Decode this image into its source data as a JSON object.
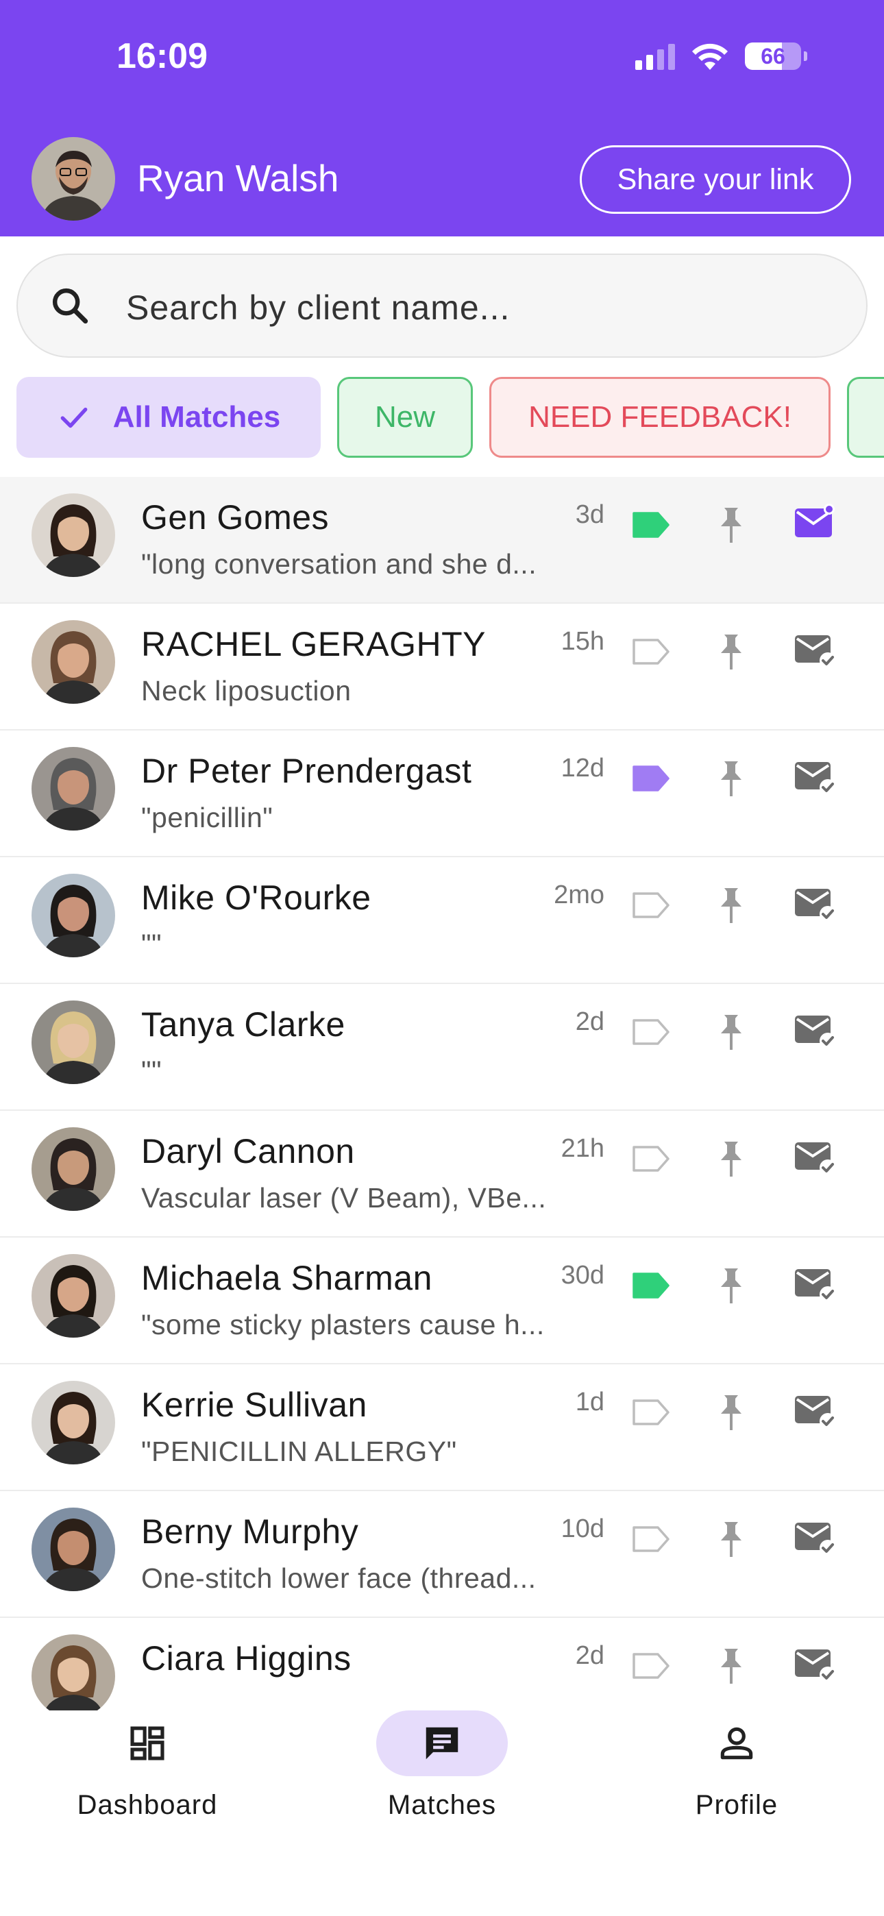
{
  "status_bar": {
    "time": "16:09",
    "battery": "66",
    "battery_level": 0.66
  },
  "header": {
    "user_name": "Ryan Walsh",
    "share_label": "Share your link"
  },
  "search": {
    "placeholder": "Search by client name..."
  },
  "filters": [
    {
      "label": "All Matches",
      "selected": true
    },
    {
      "label": "New",
      "selected": false
    },
    {
      "label": "NEED FEEDBACK!",
      "selected": false
    },
    {
      "label": "",
      "selected": false
    }
  ],
  "matches": [
    {
      "name": "Gen Gomes",
      "time": "3d",
      "preview": "\"long conversation and she d...",
      "tag": "green",
      "mail": "unread"
    },
    {
      "name": "RACHEL GERAGHTY",
      "time": "15h",
      "preview": "Neck liposuction",
      "tag": "none",
      "mail": "read"
    },
    {
      "name": "Dr Peter Prendergast",
      "time": "12d",
      "preview": "\"penicillin\"",
      "tag": "purple",
      "mail": "read"
    },
    {
      "name": "Mike O'Rourke",
      "time": "2mo",
      "preview": "\"\"",
      "tag": "none",
      "mail": "read"
    },
    {
      "name": "Tanya Clarke",
      "time": "2d",
      "preview": "\"\"",
      "tag": "none",
      "mail": "read"
    },
    {
      "name": "Daryl Cannon",
      "time": "21h",
      "preview": "Vascular laser (V Beam), VBe...",
      "tag": "none",
      "mail": "read"
    },
    {
      "name": "Michaela Sharman",
      "time": "30d",
      "preview": "\"some sticky plasters cause h...",
      "tag": "green",
      "mail": "read"
    },
    {
      "name": "Kerrie Sullivan",
      "time": "1d",
      "preview": "\"PENICILLIN ALLERGY\"",
      "tag": "none",
      "mail": "read"
    },
    {
      "name": "Berny Murphy",
      "time": "10d",
      "preview": "One-stitch lower face (thread...",
      "tag": "none",
      "mail": "read"
    },
    {
      "name": "Ciara Higgins",
      "time": "2d",
      "preview": "",
      "tag": "none",
      "mail": "read"
    }
  ],
  "bottom_nav": [
    {
      "label": "Dashboard",
      "icon": "dashboard-icon",
      "active": false
    },
    {
      "label": "Matches",
      "icon": "chat-icon",
      "active": true
    },
    {
      "label": "Profile",
      "icon": "person-icon",
      "active": false
    }
  ],
  "colors": {
    "brand": "#7b45f0",
    "tag_green": "#2fd07a",
    "tag_purple": "#a07cf3",
    "icon_grey": "#9a9a9a",
    "mail_grey": "#6b6b6b"
  }
}
